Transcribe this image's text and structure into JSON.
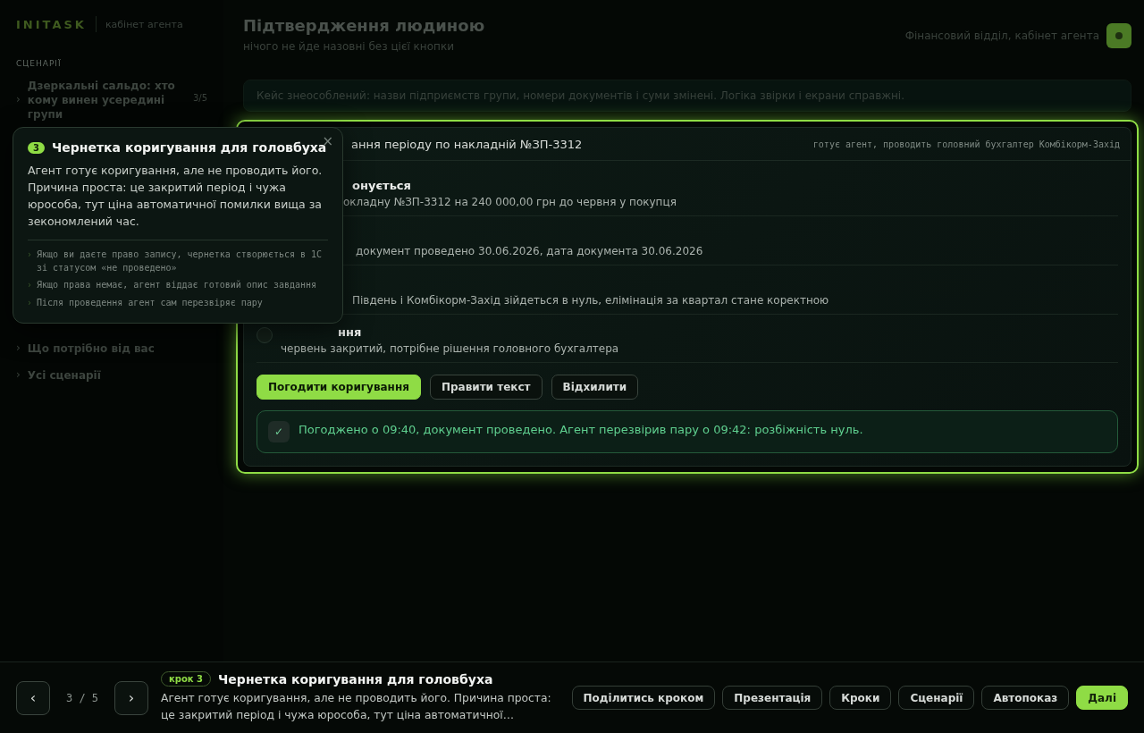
{
  "sidebar": {
    "logo": "INITASK",
    "subtitle": "кабінет агента",
    "section": "СЦЕНАРІЇ",
    "items": [
      {
        "marker": "›",
        "label": "Дзеркальні сальдо: хто кому винен усередині групи",
        "count": "3/5"
      },
      {
        "marker": "›",
        "label": "Що потрібно від вас"
      },
      {
        "marker": "›",
        "label": "Усі сценарії"
      }
    ]
  },
  "header": {
    "title": "Підтвердження людиною",
    "subtitle": "нічого не йде назовні без цієї кнопки",
    "context": "Фінансовий відділ, кабінет агента"
  },
  "notice": "Кейс знеособлений: назви підприємств групи, номери документів і суми змінені. Логіка звірки і екрани справжні.",
  "card": {
    "title": "ання періоду по накладній №ЗП-3312",
    "meta": "готує агент, проводить головний бухгалтер Комбікорм-Захід",
    "rows": [
      {
        "title": "онується",
        "text": "окладну №ЗП-3312 на 240 000,00 грн до червня у покупця"
      },
      {
        "text": "документ проведено 30.06.2026, дата документа 30.06.2026"
      },
      {
        "text": "Південь і Комбікорм-Захід зійдеться в нуль, елімінація за квартал стане коректною"
      },
      {
        "title": "ння",
        "text": "червень закритий, потрібне рішення головного бухгалтера"
      }
    ],
    "actions": [
      {
        "label": "Погодити коригування",
        "primary": true
      },
      {
        "label": "Правити текст",
        "primary": false
      },
      {
        "label": "Відхилити",
        "primary": false
      }
    ],
    "result": {
      "mark": "✓",
      "text": "Погоджено о 09:40, документ проведено. Агент перезвірив пару о 09:42: розбіжність нуль."
    }
  },
  "popover": {
    "number": "3",
    "title": "Чернетка коригування для головбуха",
    "close": "×",
    "text": "Агент готує коригування, але не проводить його. Причина проста: це закритий період і чужа юрособа, тут ціна автоматичної помилки вища за зекономлений час.",
    "bullets": [
      {
        "marker": "›",
        "text": "Якщо ви даєте право запису, чернетка створюється в 1С зі статусом «не проведено»"
      },
      {
        "marker": "›",
        "text": "Якщо права немає, агент віддає готовий опис завдання"
      },
      {
        "marker": "›",
        "text": "Після проведення агент сам перезвіряє пару"
      }
    ]
  },
  "tour": {
    "prev": "‹",
    "position": "3 / 5",
    "next": "›",
    "step": "крок 3",
    "title": "Чернетка коригування для головбуха",
    "text": "Агент готує коригування, але не проводить його. Причина проста: це закритий період і чужа юрособа, тут ціна автоматичної…",
    "buttons": [
      {
        "label": "Поділитись кроком",
        "primary": false
      },
      {
        "label": "Презентація",
        "primary": false
      },
      {
        "label": "Кроки",
        "primary": false
      },
      {
        "label": "Сценарії",
        "primary": false
      },
      {
        "label": "Автопоказ",
        "primary": false
      },
      {
        "label": "Далі",
        "primary": true
      }
    ]
  }
}
